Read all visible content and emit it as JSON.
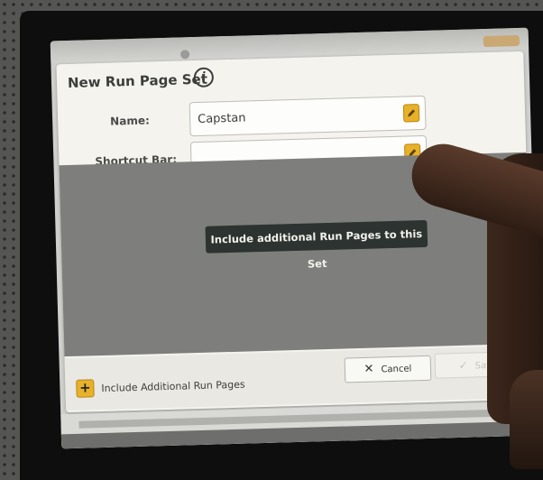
{
  "dialog": {
    "title": "New Run Page Set",
    "info_icon": "i"
  },
  "form": {
    "name_label": "Name:",
    "name_value": "Capstan",
    "shortcut_label": "Shortcut Bar:",
    "shortcut_value": ""
  },
  "list": {
    "banner": "Include additional Run Pages to this Set"
  },
  "footer": {
    "add_label": "Include Additional Run Pages",
    "add_icon": "+",
    "cancel_label": "Cancel",
    "cancel_icon": "✕",
    "save_label": "Save",
    "save_icon": "✓"
  },
  "colors": {
    "accent": "#e8b12a",
    "banner_bg": "#2c3330",
    "list_bg": "#7e7f7c",
    "dialog_bg": "#f4f3ee"
  },
  "icons": {
    "info": "info-icon",
    "edit": "pencil-icon",
    "add": "plus-icon",
    "cancel": "close-icon",
    "save": "check-icon"
  }
}
